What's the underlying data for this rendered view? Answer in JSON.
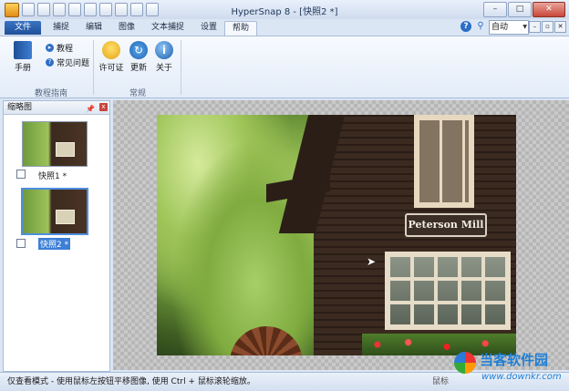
{
  "window": {
    "title": "HyperSnap 8 - [快照2 *]"
  },
  "tabs": [
    {
      "label": "文件"
    },
    {
      "label": "捕捉"
    },
    {
      "label": "编辑"
    },
    {
      "label": "图像"
    },
    {
      "label": "文本捕捉"
    },
    {
      "label": "设置"
    },
    {
      "label": "帮助"
    }
  ],
  "toolbar_right": {
    "zoom_value": "自动"
  },
  "ribbon": {
    "manual": "手册",
    "tutorial": "教程",
    "faq": "常见问题",
    "license": "许可证",
    "update": "更新",
    "about": "关于",
    "group_help": "教程指南",
    "group_general": "常规"
  },
  "thumbnails_pane": {
    "title": "缩略图",
    "items": [
      {
        "label": "快照1 *"
      },
      {
        "label": "快照2 *"
      }
    ]
  },
  "photo": {
    "sign_text": "Peterson Mill"
  },
  "status": {
    "text": "仅查看模式 - 使用鼠标左按钮平移图像, 使用 Ctrl + 鼠标滚轮缩放。",
    "right_label": "鼠标"
  },
  "watermark": {
    "name": "当客软件园",
    "url": "www.downkr.com"
  }
}
